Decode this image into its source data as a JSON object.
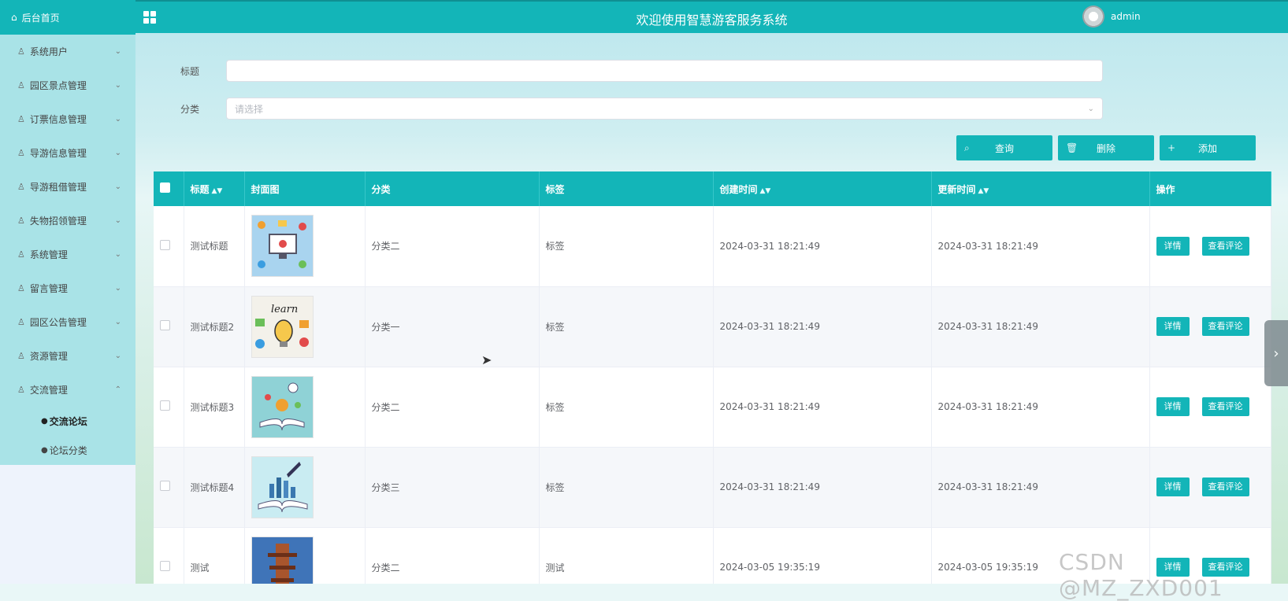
{
  "sidebar": {
    "home": "后台首页",
    "items": [
      {
        "label": "系统用户"
      },
      {
        "label": "园区景点管理"
      },
      {
        "label": "订票信息管理"
      },
      {
        "label": "导游信息管理"
      },
      {
        "label": "导游租借管理"
      },
      {
        "label": "失物招领管理"
      },
      {
        "label": "系统管理"
      },
      {
        "label": "留言管理"
      },
      {
        "label": "园区公告管理"
      },
      {
        "label": "资源管理"
      },
      {
        "label": "交流管理"
      }
    ],
    "subitems": [
      {
        "label": "交流论坛"
      },
      {
        "label": "论坛分类"
      }
    ]
  },
  "header": {
    "title": "欢迎使用智慧游客服务系统",
    "username": "admin"
  },
  "search": {
    "title_label": "标题",
    "title_value": "",
    "category_label": "分类",
    "category_placeholder": "请选择"
  },
  "actions": {
    "query": "查询",
    "delete": "删除",
    "add": "添加"
  },
  "table": {
    "headers": {
      "title": "标题",
      "cover": "封面图",
      "category": "分类",
      "tag": "标签",
      "created": "创建时间",
      "updated": "更新时间",
      "ops": "操作"
    },
    "rows": [
      {
        "title": "测试标题",
        "category": "分类二",
        "tag": "标签",
        "created": "2024-03-31 18:21:49",
        "updated": "2024-03-31 18:21:49",
        "detail": "详情",
        "comment": "查看评论"
      },
      {
        "title": "测试标题2",
        "category": "分类一",
        "tag": "标签",
        "created": "2024-03-31 18:21:49",
        "updated": "2024-03-31 18:21:49",
        "detail": "详情",
        "comment": "查看评论"
      },
      {
        "title": "测试标题3",
        "category": "分类二",
        "tag": "标签",
        "created": "2024-03-31 18:21:49",
        "updated": "2024-03-31 18:21:49",
        "detail": "详情",
        "comment": "查看评论"
      },
      {
        "title": "测试标题4",
        "category": "分类三",
        "tag": "标签",
        "created": "2024-03-31 18:21:49",
        "updated": "2024-03-31 18:21:49",
        "detail": "详情",
        "comment": "查看评论"
      },
      {
        "title": "测试",
        "category": "分类二",
        "tag": "测试",
        "created": "2024-03-05 19:35:19",
        "updated": "2024-03-05 19:35:19",
        "detail": "详情",
        "comment": "查看评论"
      }
    ]
  },
  "watermark": "CSDN @MZ_ZXD001",
  "colors": {
    "primary": "#13b5b8",
    "sidebar_menu": "#a9e3e7"
  }
}
